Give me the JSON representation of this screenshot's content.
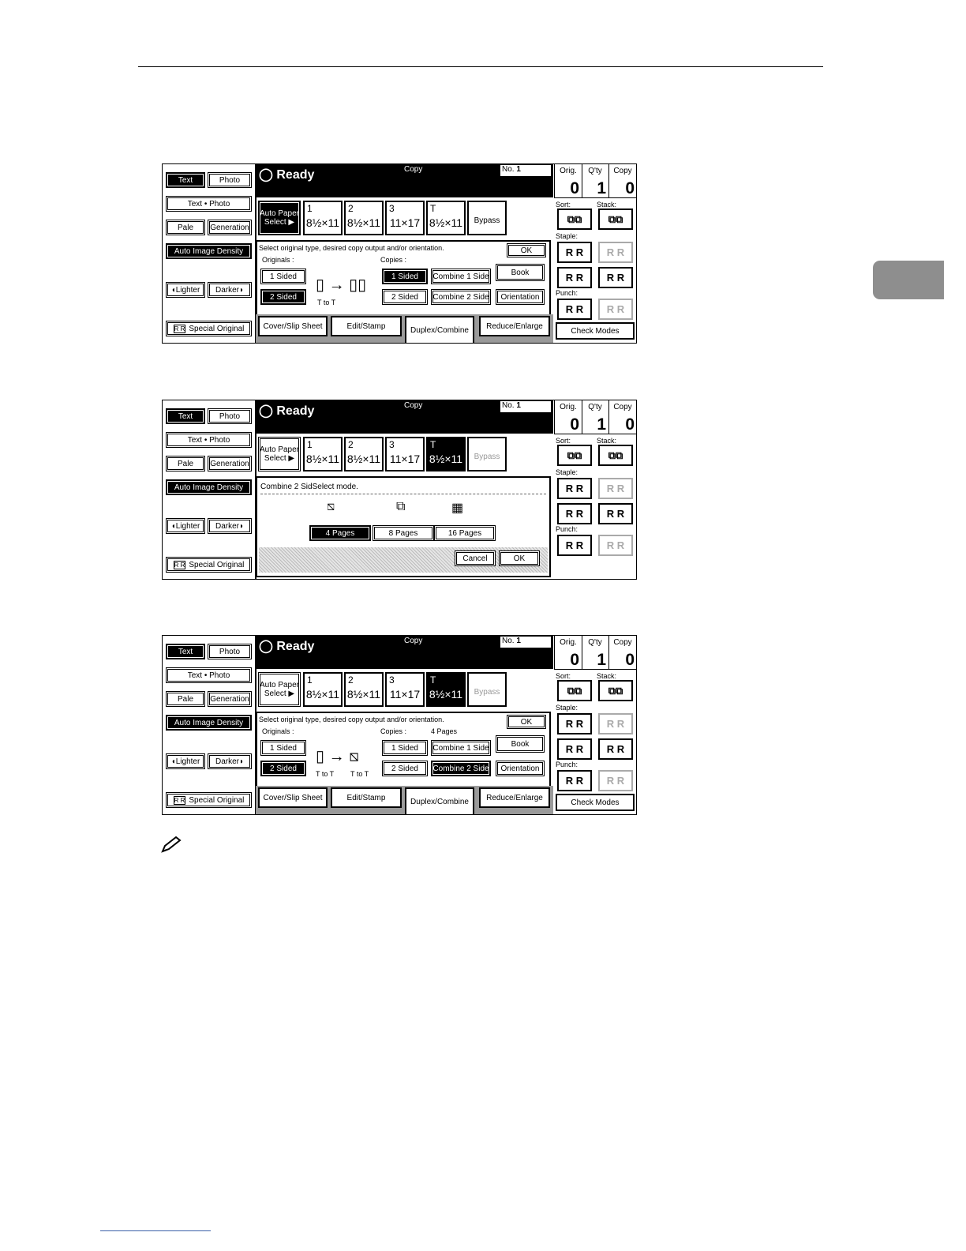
{
  "screen_common": {
    "text": "Text",
    "photo": "Photo",
    "text_photo": "Text • Photo",
    "pale": "Pale",
    "generation": "Generation",
    "auto_density": "Auto Image Density",
    "lighter": "Lighter",
    "darker": "Darker",
    "special_original": "Special Original",
    "ready": "Ready",
    "copy_label": "Copy",
    "no_label": "No.",
    "no_value": "1",
    "orig_label": "Orig.",
    "orig_value": "0",
    "qty_label": "Q'ty",
    "qty_value": "1",
    "copy_count_label": "Copy",
    "copy_count_value": "0",
    "auto_paper_1": "Auto Paper",
    "auto_paper_2": "Select",
    "tray1_num": "1",
    "tray1_size": "8½×11",
    "tray2_num": "2",
    "tray2_size": "8½×11",
    "tray3_num": "3",
    "tray3_size": "11×17",
    "trayT_num": "T",
    "trayT_size": "8½×11",
    "bypass": "Bypass",
    "sort_label": "Sort:",
    "stack_label": "Stack:",
    "staple_label": "Staple:",
    "punch_label": "Punch:",
    "check_modes": "Check Modes"
  },
  "panel1": {
    "instruction": "Select original type, desired copy output and/or orientation.",
    "ok": "OK",
    "originals": "Originals :",
    "copies": "Copies :",
    "o_1sided": "1 Sided",
    "o_2sided": "2 Sided",
    "c_1sided": "1 Sided",
    "c_2sided": "2 Sided",
    "comb1": "Combine 1 Side",
    "comb2": "Combine 2 Side",
    "book": "Book",
    "orientation": "Orientation",
    "t_to_t": "T to T"
  },
  "panel2": {
    "title": "Combine 2 SidSelect mode.",
    "p4": "4 Pages",
    "p8": "8 Pages",
    "p16": "16 Pages",
    "cancel": "Cancel",
    "ok": "OK"
  },
  "panel3": {
    "four_pages": "4 Pages",
    "t_to_t_2": "T to T"
  },
  "tabs": {
    "cover": "Cover/Slip Sheet",
    "edit": "Edit/Stamp",
    "duplex": "Duplex/Combine",
    "reduce": "Reduce/Enlarge"
  }
}
